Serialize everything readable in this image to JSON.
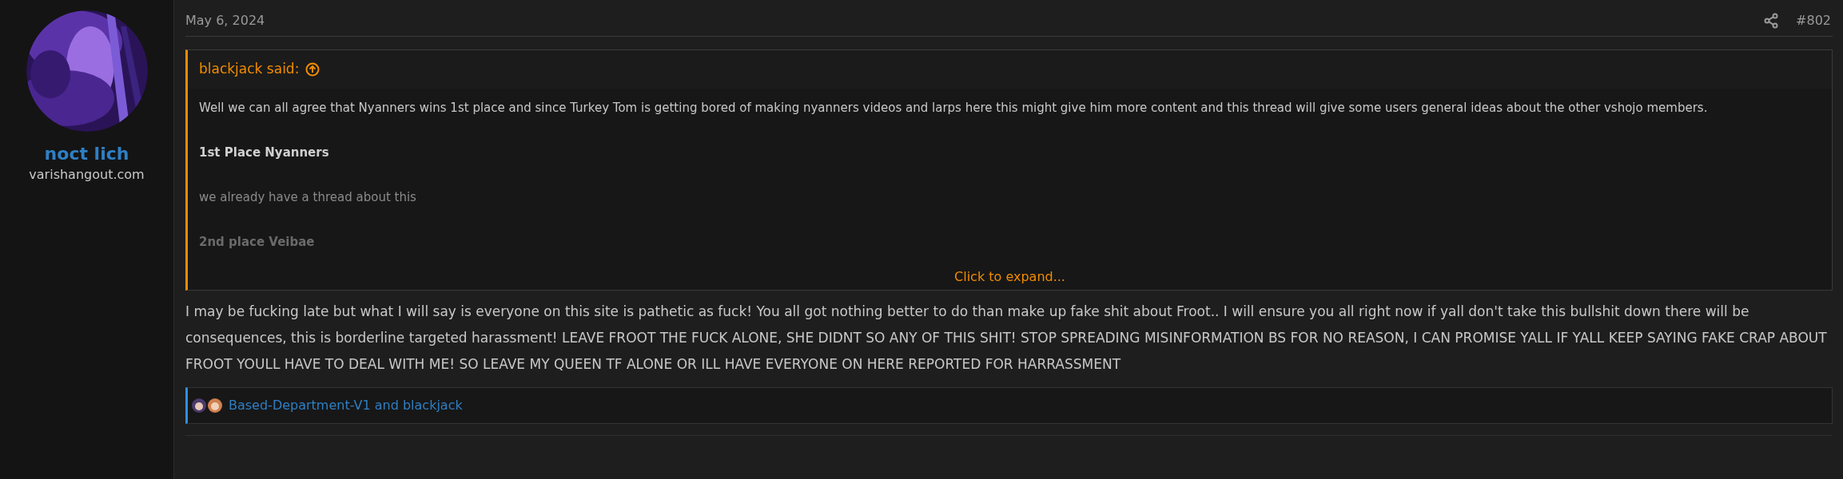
{
  "author": {
    "name": "noct lich",
    "title": "varishangout.com"
  },
  "post": {
    "date": "May 6, 2024",
    "number": "#802"
  },
  "quote": {
    "header": "blackjack said:",
    "paragraphs": [
      {
        "kind": "normal",
        "text": "Well we can all agree that Nyanners wins 1st place and since Turkey Tom is getting bored of making nyanners videos and larps here this might give him more content and this thread will give some users general ideas about the other vshojo members."
      },
      {
        "kind": "bold",
        "text": "1st Place Nyanners"
      },
      {
        "kind": "muted",
        "text": "we already have a thread about this"
      },
      {
        "kind": "faded",
        "text": "2nd place Veibae"
      }
    ],
    "expand": "Click to expand..."
  },
  "body": "I may be fucking late but what I will say is everyone on this site is pathetic as fuck! You all got nothing better to do than make up fake shit about Froot.. I will ensure you all right now if yall don't take this bullshit down there will be consequences, this is borderline targeted harassment! LEAVE FROOT THE FUCK ALONE, SHE DIDNT SO ANY OF THIS SHIT! STOP SPREADING MISINFORMATION BS FOR NO REASON, I CAN PROMISE YALL IF YALL KEEP SAYING FAKE CRAP ABOUT FROOT YOULL HAVE TO DEAL WITH ME! SO LEAVE MY QUEEN TF ALONE OR ILL HAVE EVERYONE ON HERE REPORTED FOR HARRASSMENT",
  "reactions": {
    "text": "Based-Department-V1 and blackjack"
  }
}
